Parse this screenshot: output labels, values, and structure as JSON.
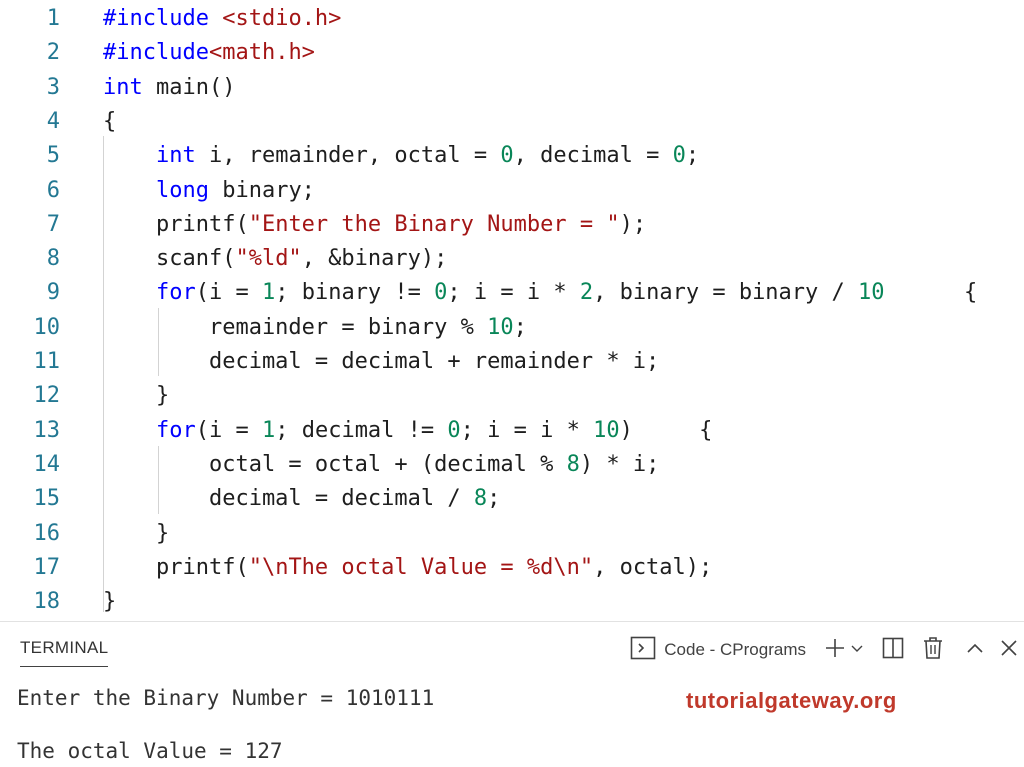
{
  "editor": {
    "lines": [
      {
        "n": "1",
        "tokens": [
          [
            "kw",
            "#include"
          ],
          [
            "",
            " "
          ],
          [
            "str",
            "<stdio.h>"
          ]
        ]
      },
      {
        "n": "2",
        "tokens": [
          [
            "kw",
            "#include"
          ],
          [
            "str",
            "<math.h>"
          ]
        ]
      },
      {
        "n": "3",
        "tokens": [
          [
            "kw",
            "int"
          ],
          [
            "",
            " main()"
          ]
        ]
      },
      {
        "n": "4",
        "tokens": [
          [
            "",
            "{"
          ]
        ]
      },
      {
        "n": "5",
        "tokens": [
          [
            "",
            "    "
          ],
          [
            "kw",
            "int"
          ],
          [
            "",
            " i, remainder, octal = "
          ],
          [
            "num",
            "0"
          ],
          [
            "",
            ", decimal = "
          ],
          [
            "num",
            "0"
          ],
          [
            "",
            ";"
          ]
        ]
      },
      {
        "n": "6",
        "tokens": [
          [
            "",
            "    "
          ],
          [
            "kw",
            "long"
          ],
          [
            "",
            " binary;"
          ]
        ]
      },
      {
        "n": "7",
        "tokens": [
          [
            "",
            "    printf("
          ],
          [
            "str",
            "\"Enter the Binary Number = \""
          ],
          [
            "",
            ");"
          ]
        ]
      },
      {
        "n": "8",
        "tokens": [
          [
            "",
            "    scanf("
          ],
          [
            "str",
            "\"%ld\""
          ],
          [
            "",
            ", &binary);"
          ]
        ]
      },
      {
        "n": "9",
        "tokens": [
          [
            "",
            "    "
          ],
          [
            "kw",
            "for"
          ],
          [
            "",
            "(i = "
          ],
          [
            "num",
            "1"
          ],
          [
            "",
            "; binary != "
          ],
          [
            "num",
            "0"
          ],
          [
            "",
            "; i = i * "
          ],
          [
            "num",
            "2"
          ],
          [
            "",
            ", binary = binary / "
          ],
          [
            "num",
            "10"
          ],
          [
            ")",
            "      {"
          ]
        ]
      },
      {
        "n": "10",
        "tokens": [
          [
            "",
            "        remainder = binary % "
          ],
          [
            "num",
            "10"
          ],
          [
            "",
            ";"
          ]
        ]
      },
      {
        "n": "11",
        "tokens": [
          [
            "",
            "        decimal = decimal + remainder * i;"
          ]
        ]
      },
      {
        "n": "12",
        "tokens": [
          [
            "",
            "    }"
          ]
        ]
      },
      {
        "n": "13",
        "tokens": [
          [
            "",
            "    "
          ],
          [
            "kw",
            "for"
          ],
          [
            "",
            "(i = "
          ],
          [
            "num",
            "1"
          ],
          [
            "",
            "; decimal != "
          ],
          [
            "num",
            "0"
          ],
          [
            "",
            "; i = i * "
          ],
          [
            "num",
            "10"
          ],
          [
            "",
            ")     {"
          ]
        ]
      },
      {
        "n": "14",
        "tokens": [
          [
            "",
            "        octal = octal + (decimal % "
          ],
          [
            "num",
            "8"
          ],
          [
            "",
            ") * i;"
          ]
        ]
      },
      {
        "n": "15",
        "tokens": [
          [
            "",
            "        decimal = decimal / "
          ],
          [
            "num",
            "8"
          ],
          [
            "",
            ";"
          ]
        ]
      },
      {
        "n": "16",
        "tokens": [
          [
            "",
            "    }"
          ]
        ]
      },
      {
        "n": "17",
        "tokens": [
          [
            "",
            "    printf("
          ],
          [
            "str",
            "\"\\nThe octal Value = %d\\n\""
          ],
          [
            "",
            ", octal);"
          ]
        ]
      },
      {
        "n": "18",
        "tokens": [
          [
            "",
            "}"
          ]
        ]
      }
    ]
  },
  "terminal": {
    "tab_label": "TERMINAL",
    "shell_label": "Code - CPrograms",
    "output": [
      "Enter the Binary Number = 1010111",
      "The octal Value = 127"
    ]
  },
  "watermark": "tutorialgateway.org",
  "colors": {
    "keyword": "#0000ff",
    "string": "#a31515",
    "number": "#098658",
    "line_number": "#237893",
    "watermark": "#c0392b"
  }
}
